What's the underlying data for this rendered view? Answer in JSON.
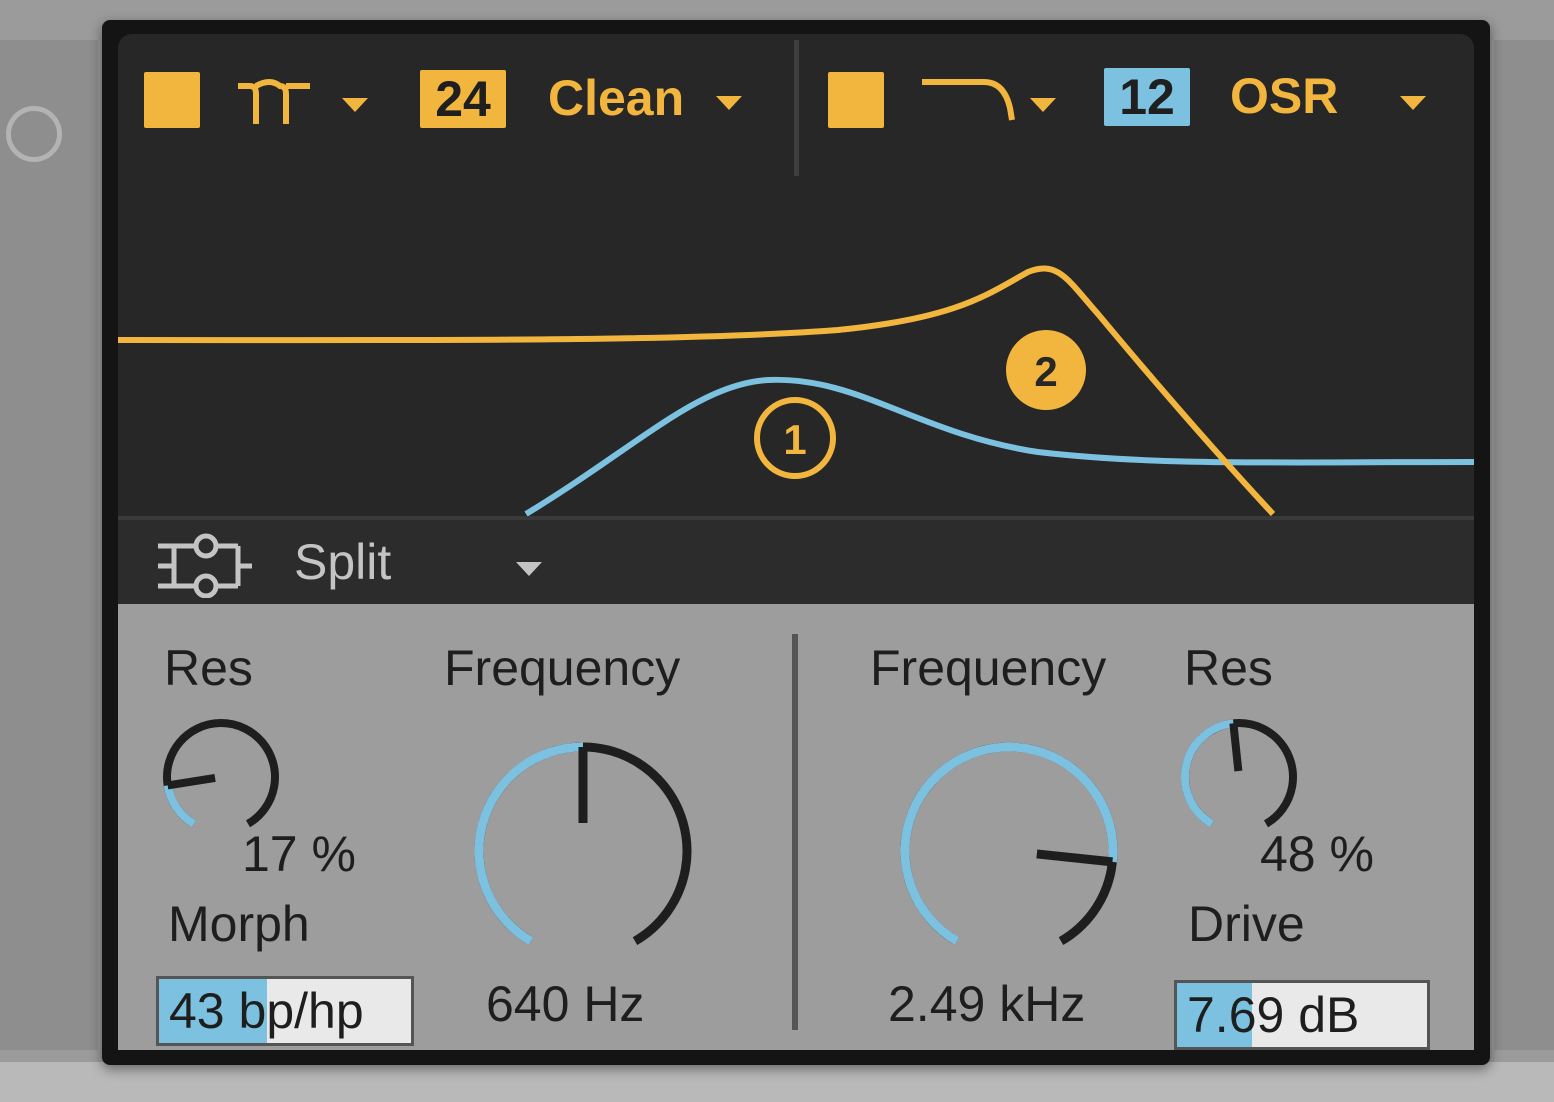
{
  "filter1": {
    "slope": "24",
    "circuit": "Clean",
    "res_label": "Res",
    "res_value": "17 %",
    "res_level": 0.17,
    "frequency_label": "Frequency",
    "frequency_value": "640 Hz",
    "frequency_level": 0.5,
    "morph_label": "Morph",
    "morph_value": "43",
    "morph_unit": "bp/hp",
    "morph_level": 0.43,
    "marker": "1"
  },
  "filter2": {
    "slope": "12",
    "circuit": "OSR",
    "frequency_label": "Frequency",
    "frequency_value": "2.49 kHz",
    "frequency_level": 0.82,
    "res_label": "Res",
    "res_value": "48 %",
    "res_level": 0.48,
    "drive_label": "Drive",
    "drive_value": "7.69 dB",
    "drive_level": 0.3,
    "marker": "2"
  },
  "routing": {
    "label": "Split"
  },
  "icons": {
    "filter1_type": "bandpass-filter-icon",
    "filter2_type": "lowpass-filter-icon",
    "routing": "split-routing-icon"
  },
  "colors": {
    "accent_yellow": "#f2b63f",
    "accent_blue": "#7cc2e0",
    "panel_dark": "#272727",
    "controls_bg": "#9d9d9d"
  }
}
